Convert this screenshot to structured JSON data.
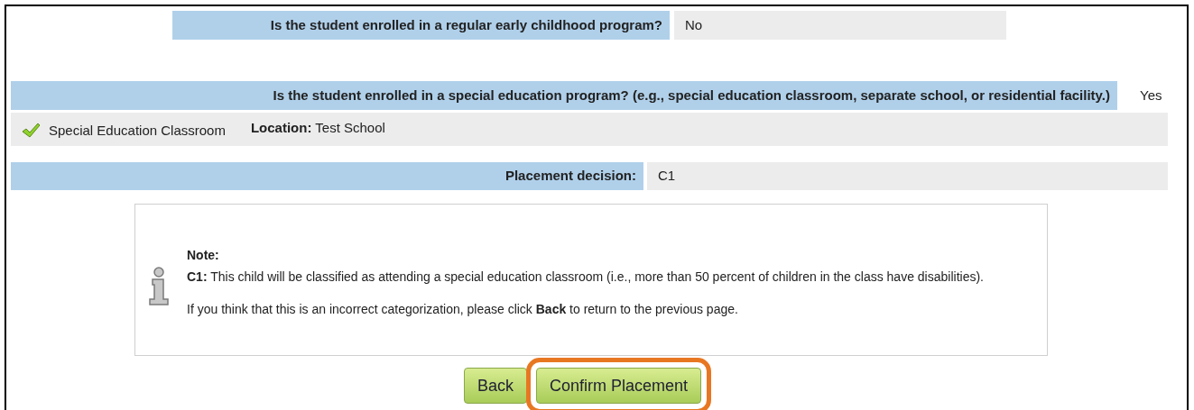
{
  "questions": [
    {
      "kind": "short",
      "label": "Is the student enrolled in a regular early childhood program?",
      "answer": "No"
    },
    {
      "kind": "long",
      "label": "Is the student enrolled in a special education program? (e.g., special education classroom, separate school, or residential facility.)",
      "answer": "Yes"
    }
  ],
  "setting": {
    "checked": true,
    "name": "Special Education Classroom",
    "location_label": "Location:",
    "location": "Test School"
  },
  "placement": {
    "label": "Placement decision:",
    "value": "C1"
  },
  "note": {
    "title": "Note:",
    "text": "**C1:** This child will be classified as attending a special education classroom (i.e., more than 50 percent of children in the class have disabilities).",
    "hint": "If you think that this is an incorrect categorization, please click **Back** to return to the previous page."
  },
  "buttons": [
    {
      "label": "Back",
      "highlighted": false
    },
    {
      "label": "Confirm Placement",
      "highlighted": true
    }
  ]
}
